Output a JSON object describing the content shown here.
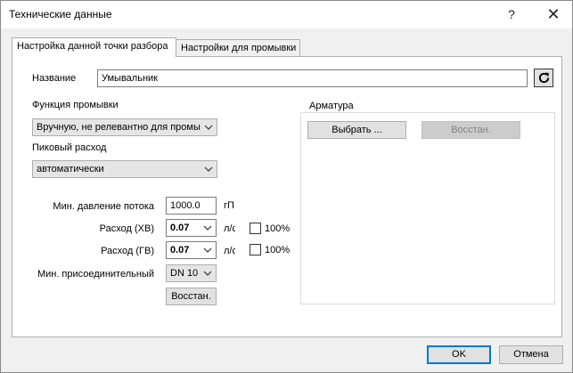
{
  "window": {
    "title": "Технические данные",
    "help_label": "?",
    "close_label": "✕"
  },
  "tabs": [
    {
      "label": "Настройка данной точки разбора",
      "active": true
    },
    {
      "label": "Настройки для промывки",
      "active": false
    }
  ],
  "form": {
    "name_label": "Название",
    "name_value": "Умывальник",
    "flush_function_label": "Функция промывки",
    "flush_function_value": "Вручную, не релевантно для промы",
    "peak_flow_label": "Пиковый расход",
    "peak_flow_value": "автоматически",
    "min_pressure_label": "Мин. давление потока",
    "min_pressure_value": "1000.0",
    "min_pressure_unit": "гП",
    "flow_cold_label": "Расход (ХВ)",
    "flow_cold_value": "0.07",
    "flow_cold_unit": "л/с",
    "flow_cold_check_label": "100%",
    "flow_hot_label": "Расход (ГВ)",
    "flow_hot_value": "0.07",
    "flow_hot_unit": "л/с",
    "flow_hot_check_label": "100%",
    "min_connection_label": "Мин. присоединительный",
    "min_connection_value": "DN 10",
    "restore_label": "Восстан."
  },
  "fittings": {
    "group_label": "Арматура",
    "select_label": "Выбрать ...",
    "restore_label": "Восстан."
  },
  "footer": {
    "ok_label": "OK",
    "cancel_label": "Отмена"
  },
  "icons": {
    "refresh": "refresh-icon",
    "dropdown": "chevron-down-icon"
  },
  "colors": {
    "accent": "#0078d7",
    "panel_bg": "#ffffff",
    "dialog_bg": "#f0f0f0"
  }
}
